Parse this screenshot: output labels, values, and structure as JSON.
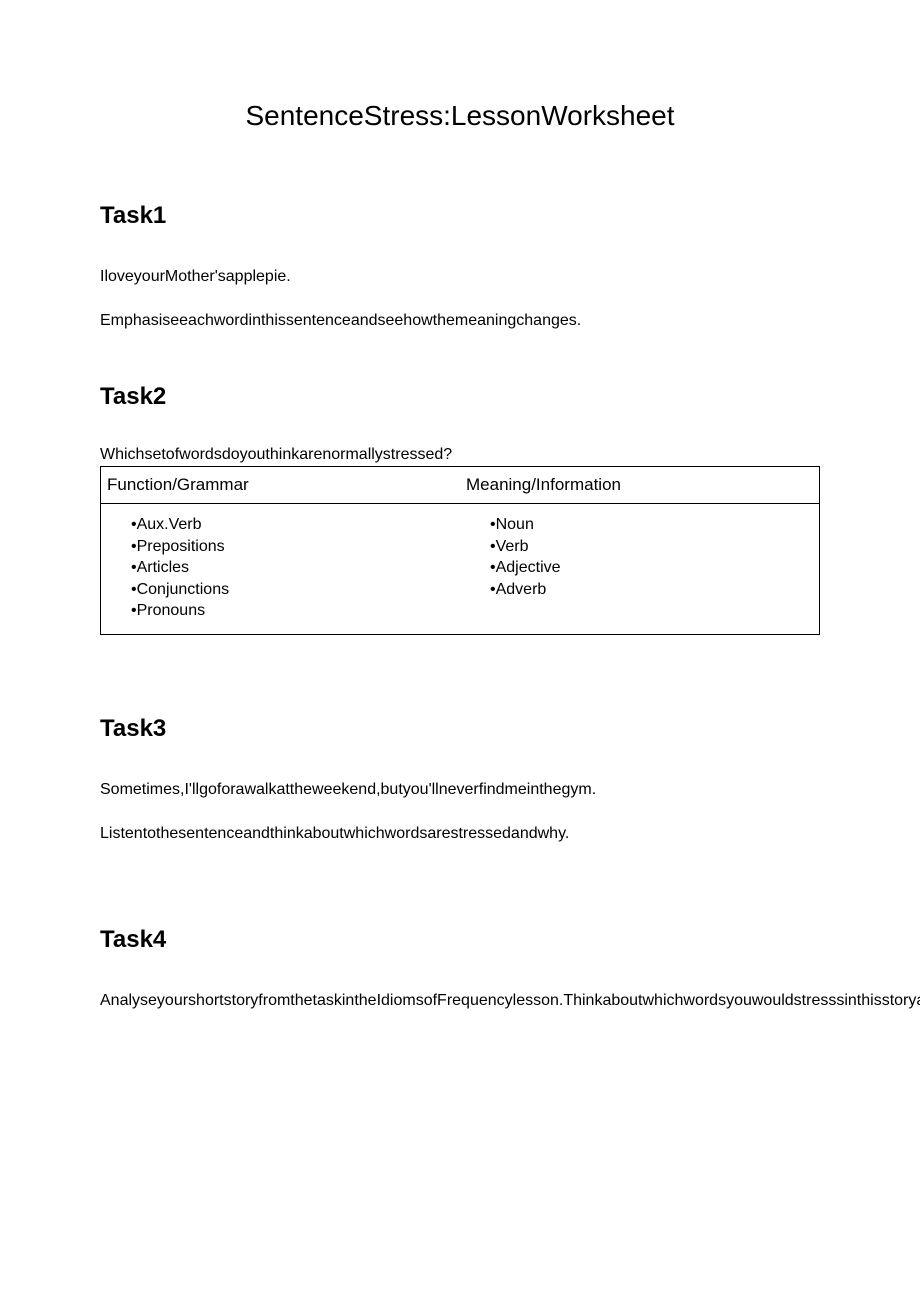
{
  "title": "SentenceStress:LessonWorksheet",
  "task1": {
    "heading": "Task1",
    "line1": "IloveyourMother'sapplepie.",
    "line2": "Emphasiseeachwordinthissentenceandseehowthemeaningchanges."
  },
  "task2": {
    "heading": "Task2",
    "question": "Whichsetofwordsdoyouthinkarenormallystressed?",
    "col1_header": "Function/Grammar",
    "col2_header": "Meaning/Information",
    "col1_items": {
      "i0": "•Aux.Verb",
      "i1": "•Prepositions",
      "i2": "•Articles",
      "i3": "•Conjunctions",
      "i4": "•Pronouns"
    },
    "col2_items": {
      "i0": "•Noun",
      "i1": "•Verb",
      "i2": "•Adjective",
      "i3": "•Adverb"
    }
  },
  "task3": {
    "heading": "Task3",
    "line1": "Sometimes,I'llgoforawalkattheweekend,butyou'llneverfindmeinthegym.",
    "line2": "Listentothesentenceandthinkaboutwhichwordsarestressedandwhy."
  },
  "task4": {
    "heading": "Task4",
    "line1": "AnalyseyourshortstoryfromthetaskintheIdiomsofFrequencylesson.Thinkaboutwhichwordsyouwouldstresssinthisstoryandpostitbelowthelesson."
  }
}
